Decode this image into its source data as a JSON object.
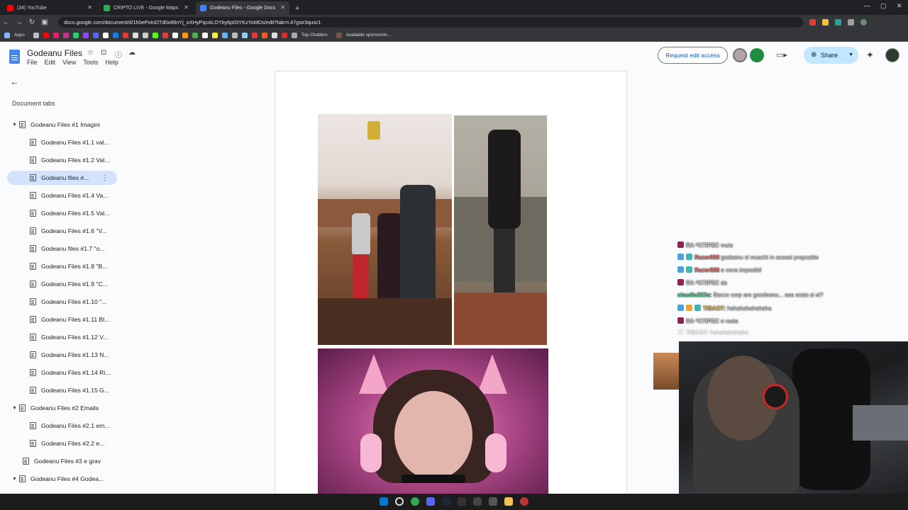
{
  "browser": {
    "tabs": [
      {
        "label": "(34) YouTube",
        "color": "#ff0000"
      },
      {
        "label": "CRIPTO LIVE - Google Maps",
        "color": "#34a853"
      },
      {
        "label": "Godeanu Files - Google Docs",
        "color": "#4285f4"
      }
    ],
    "new_tab": "+",
    "url": "docs.google.com/document/d/1h0ePoInDTd0x89nYj_oXHyPqcALOYky6p03YKzYoMDs/edit?tab=t.47gsir3qusc1",
    "bookmarks": {
      "apps": "Apps",
      "top_chatters": "Top Chatters",
      "sponsors": "Available sponsorsh..."
    }
  },
  "docs": {
    "title": "Godeanu Files",
    "menu": [
      "File",
      "Edit",
      "View",
      "Tools",
      "Help"
    ],
    "request_edit_access": "Request edit access",
    "share": "Share",
    "accent": "#c2e7ff"
  },
  "sidebar": {
    "heading": "Document tabs",
    "items": [
      {
        "label": "Godeanu Files #1 Imagini",
        "level": 1,
        "expanded": true
      },
      {
        "label": "Godeanu Files #1.1 val...",
        "level": 2
      },
      {
        "label": "Godeanu Files #1.2 Val...",
        "level": 2
      },
      {
        "label": "Godeanu files #...",
        "level": 2,
        "selected": true
      },
      {
        "label": "Godeanu Files #1.4 Va...",
        "level": 2
      },
      {
        "label": "Godeanu Files #1.5 Val...",
        "level": 2
      },
      {
        "label": "Godeanu Files #1.6 \"V...",
        "level": 2
      },
      {
        "label": "Godeanu files #1.7 \"o...",
        "level": 2
      },
      {
        "label": "Godeanu Files #1.8 \"B...",
        "level": 2
      },
      {
        "label": "Godeanu Files #1.9 \"C...",
        "level": 2
      },
      {
        "label": "Godeanu Files #1.10 \"...",
        "level": 2
      },
      {
        "label": "Godeanu Files #1.11 Bl...",
        "level": 2
      },
      {
        "label": "Godeanu Files #1.12 V...",
        "level": 2
      },
      {
        "label": "Godeanu Files #1.13 N...",
        "level": 2
      },
      {
        "label": "Godeanu Files #1.14 Ri...",
        "level": 2
      },
      {
        "label": "Godeanu Files #1.15 G...",
        "level": 2
      },
      {
        "label": "Godeanu Files #2 Emails",
        "level": 1,
        "expanded": true
      },
      {
        "label": "Godeanu Files #2.1 em...",
        "level": 2
      },
      {
        "label": "Godeanu Files #2.2 e...",
        "level": 2
      },
      {
        "label": "Godeanu Files #3 e grav",
        "level": 1
      },
      {
        "label": "Godeanu Files #4 Godea...",
        "level": 1,
        "expanded": true
      }
    ]
  },
  "chat": [
    {
      "user": "RA ᴬKTIPEC",
      "msg": "muie"
    },
    {
      "user": "Razer888",
      "msg": "godeanu si muschi in aceasi propozitie"
    },
    {
      "user": "Razer888",
      "msg": "e ceva imposibil"
    },
    {
      "user": "RA ᴬKTIPEC",
      "msg": "da"
    },
    {
      "user": "claudiu323s:",
      "msg": "Bacce corp are goodeanu... asa arata si el?"
    },
    {
      "user": "TIBAO7:",
      "msg": "hahahahahahaha"
    },
    {
      "user": "RA ᴬKTIPEC",
      "msg": "e reala"
    },
    {
      "user": "TIBAO7:",
      "msg": "hahahahahaha"
    }
  ]
}
